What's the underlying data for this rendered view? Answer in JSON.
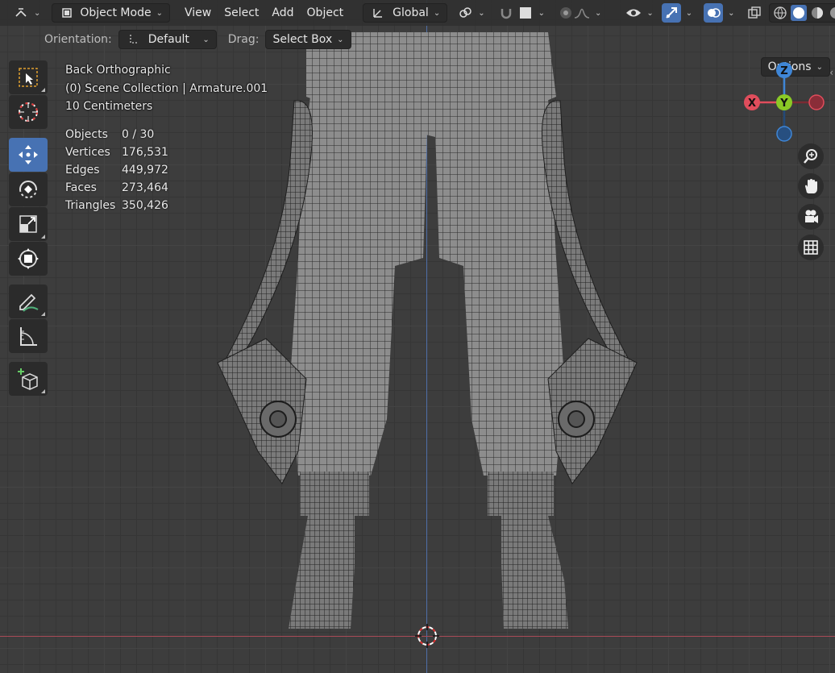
{
  "header": {
    "mode_label": "Object Mode",
    "menus": [
      "View",
      "Select",
      "Add",
      "Object"
    ],
    "transform_orientation": "Global"
  },
  "tool_settings": {
    "orientation_label": "Orientation:",
    "orientation_value": "Default",
    "drag_label": "Drag:",
    "drag_value": "Select Box",
    "options_label": "Options"
  },
  "viewport_info": {
    "view_name": "Back Orthographic",
    "collection": "(0) Scene Collection | Armature.001",
    "grid_scale": "10 Centimeters"
  },
  "stats": [
    {
      "label": "Objects",
      "value": "0 / 30"
    },
    {
      "label": "Vertices",
      "value": "176,531"
    },
    {
      "label": "Edges",
      "value": "449,972"
    },
    {
      "label": "Faces",
      "value": "273,464"
    },
    {
      "label": "Triangles",
      "value": "350,426"
    }
  ],
  "gizmo": {
    "x_label": "X",
    "y_label": "Y",
    "z_label": "Z"
  },
  "colors": {
    "accent": "#4772b3",
    "x_axis": "#e04d5c",
    "y_axis": "#8ac926",
    "z_axis": "#3f86d6"
  }
}
